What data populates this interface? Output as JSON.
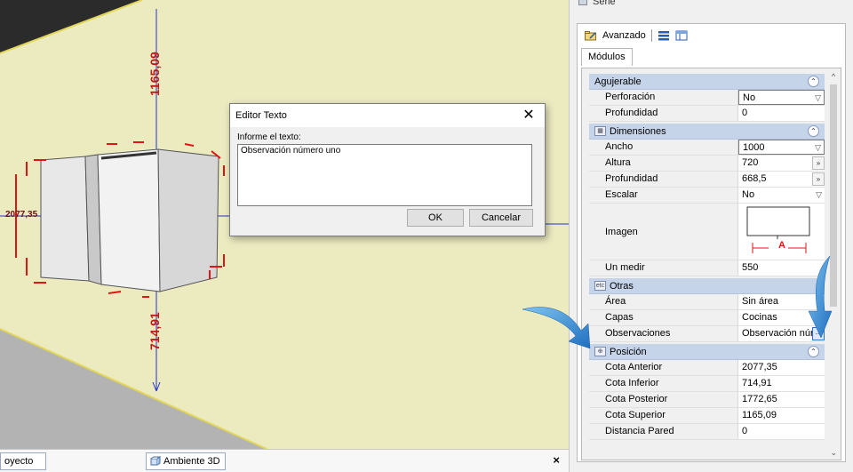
{
  "viewport": {
    "dimensions": {
      "top": "1165,09",
      "bottom": "714,91",
      "left": "2077,35"
    }
  },
  "dialog": {
    "title": "Editor Texto",
    "prompt": "Informe el texto:",
    "text_value": "Observación número uno",
    "ok_label": "OK",
    "cancel_label": "Cancelar",
    "close_glyph": "✕"
  },
  "bottom_tabs": {
    "tab1": "oyecto",
    "tab2": "Ambiente 3D",
    "close": "×"
  },
  "panel": {
    "serie_label": "Serie",
    "toolbar_label": "Avanzado",
    "tab_label": "Módulos",
    "categories": [
      {
        "name": "Agujerable",
        "rows": [
          {
            "label": "Perforación",
            "value": "No",
            "control": "dropdown"
          },
          {
            "label": "Profundidad",
            "value": "0",
            "control": "text"
          }
        ]
      },
      {
        "name": "Dimensiones",
        "rows": [
          {
            "label": "Ancho",
            "value": "1000",
            "control": "dropdown"
          },
          {
            "label": "Altura",
            "value": "720",
            "control": "ellipsis"
          },
          {
            "label": "Profundidad",
            "value": "668,5",
            "control": "ellipsis"
          },
          {
            "label": "Escalar",
            "value": "No",
            "control": "dropdown"
          },
          {
            "label": "Imagen",
            "value": "",
            "control": "image"
          },
          {
            "label": "Un medir",
            "value": "550",
            "control": "text"
          }
        ]
      },
      {
        "name": "Otras",
        "rows": [
          {
            "label": "Área",
            "value": "Sin área",
            "control": "text"
          },
          {
            "label": "Capas",
            "value": "Cocinas",
            "control": "text"
          },
          {
            "label": "Observaciones",
            "value": "Observación núr",
            "control": "ellipsis-highlight"
          }
        ]
      },
      {
        "name": "Posición",
        "rows": [
          {
            "label": "Cota Anterior",
            "value": "2077,35",
            "control": "text"
          },
          {
            "label": "Cota Inferior",
            "value": "714,91",
            "control": "text"
          },
          {
            "label": "Cota Posterior",
            "value": "1772,65",
            "control": "text"
          },
          {
            "label": "Cota Superior",
            "value": "1165,09",
            "control": "text"
          },
          {
            "label": "Distancia Pared",
            "value": "0",
            "control": "text"
          }
        ]
      }
    ],
    "image_label": "A"
  },
  "colors": {
    "wall": "#ecebc0",
    "floor": "#aaaaaa",
    "dimension_red": "#e01515",
    "dimension_blue": "#2233cc",
    "category_header": "#c6d4ea",
    "arrow_blue": "#1f8ad8"
  }
}
